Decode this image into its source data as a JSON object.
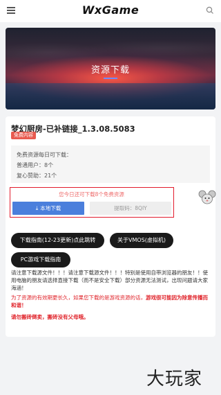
{
  "header": {
    "logo": "WxGame",
    "menu_icon": "hamburger-menu-icon",
    "search_icon": "search-icon"
  },
  "hero": {
    "title": "资源下载"
  },
  "app": {
    "title": "梦幻厨房-已补链接_1.3.08.5083",
    "badge": "免费内容"
  },
  "quota": {
    "heading": "免费资源每日可下载：",
    "normal": "普通用户：8个",
    "vip": "复心赞助：21个"
  },
  "download": {
    "notice": "您今日还可下载8个免费资源",
    "local_label": "本地下载",
    "code_label": "提取码：8QIY"
  },
  "buttons": {
    "guide": "下载指南(12-23更新)点此跳转",
    "vmos": "关于VMOS(虚拟机)",
    "pc_guide": "PC游戏下载指南"
  },
  "notes": {
    "black": "请注意下载源文件！！！请注意下载源文件！！！特别是使用自带浏览器的朋友！！使用电脑的朋友请选择直接下载（而不是安全下载）部分资源无法测试，出现问题请大家海涵！",
    "red_normal": "为了资源的有效期更长久，如果您下载的是游戏资源的话，",
    "red_bold": "游戏很可能因为除意传播而和谐！",
    "bold": "请勿搬砖倒卖，搬砖没有父母哦。"
  },
  "watermark": "大玩家",
  "colors": {
    "accent_blue": "#4b7fdc",
    "badge_red": "#e85a4f",
    "alert_red": "#e21b2c"
  }
}
